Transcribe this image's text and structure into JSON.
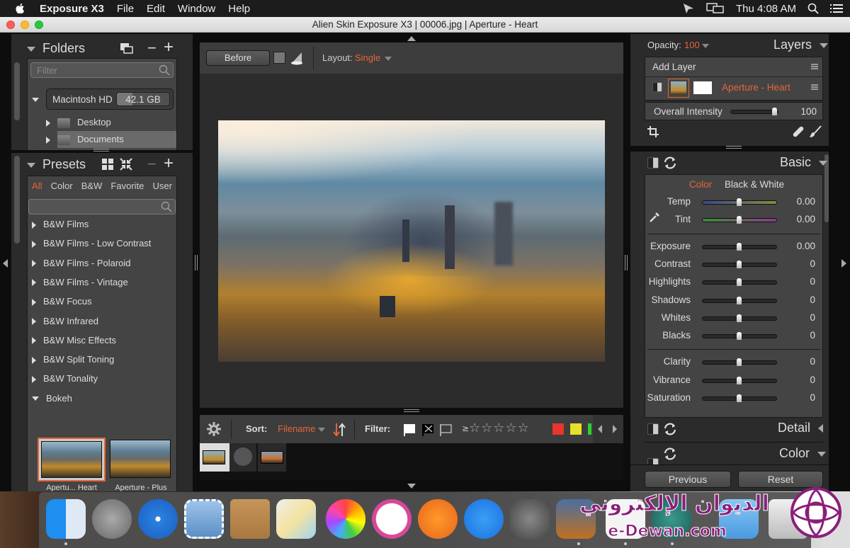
{
  "menubar": {
    "app_name": "Exposure X3",
    "items": [
      "File",
      "Edit",
      "Window",
      "Help"
    ],
    "clock": "Thu 4:08 AM"
  },
  "window": {
    "title": "Alien Skin Exposure X3 | 00006.jpg | Aperture - Heart"
  },
  "folders": {
    "header": "Folders",
    "filter_placeholder": "Filter",
    "drive": {
      "name": "Macintosh HD",
      "size": "42.1 GB",
      "used_fraction": 0.3
    },
    "items": [
      {
        "label": "Desktop",
        "selected": false
      },
      {
        "label": "Documents",
        "selected": true
      }
    ]
  },
  "presets": {
    "header": "Presets",
    "tabs": [
      {
        "label": "All",
        "active": true
      },
      {
        "label": "Color",
        "active": false
      },
      {
        "label": "B&W",
        "active": false
      },
      {
        "label": "Favorite",
        "active": false
      },
      {
        "label": "User",
        "active": false
      }
    ],
    "search_placeholder": "",
    "groups": [
      {
        "label": "B&W Films",
        "expanded": false
      },
      {
        "label": "B&W Films - Low Contrast",
        "expanded": false
      },
      {
        "label": "B&W Films - Polaroid",
        "expanded": false
      },
      {
        "label": "B&W Films - Vintage",
        "expanded": false
      },
      {
        "label": "B&W Focus",
        "expanded": false
      },
      {
        "label": "B&W Infrared",
        "expanded": false
      },
      {
        "label": "B&W Misc Effects",
        "expanded": false
      },
      {
        "label": "B&W Split Toning",
        "expanded": false
      },
      {
        "label": "B&W Tonality",
        "expanded": false
      },
      {
        "label": "Bokeh",
        "expanded": true
      }
    ],
    "thumbnails": [
      {
        "label": "Apertu... Heart",
        "selected": true
      },
      {
        "label": "Aperture - Plus",
        "selected": false
      }
    ]
  },
  "viewer": {
    "before_label": "Before",
    "layout_label": "Layout:",
    "layout_value": "Single"
  },
  "filmstrip": {
    "sort_label": "Sort:",
    "sort_value": "Filename",
    "filter_label": "Filter:",
    "rating_prefix": "≥",
    "stars": 5,
    "color_labels": [
      "#e8362a",
      "#e6e02a",
      "#2ad62a"
    ]
  },
  "layers": {
    "opacity_label": "Opacity:",
    "opacity_value": "100",
    "header": "Layers",
    "add_layer": "Add Layer",
    "layer_name": "Aperture - Heart",
    "intensity_label": "Overall Intensity",
    "intensity_value": "100",
    "intensity_fraction": 1.0
  },
  "basic": {
    "header": "Basic",
    "mode_tabs": [
      {
        "label": "Color",
        "active": true
      },
      {
        "label": "Black & White",
        "active": false
      }
    ],
    "groups": [
      [
        {
          "label": "Temp",
          "value": "0.00",
          "fraction": 0.5
        },
        {
          "label": "Tint",
          "value": "0.00",
          "fraction": 0.5
        }
      ],
      [
        {
          "label": "Exposure",
          "value": "0.00",
          "fraction": 0.5
        },
        {
          "label": "Contrast",
          "value": "0",
          "fraction": 0.5
        },
        {
          "label": "Highlights",
          "value": "0",
          "fraction": 0.5
        },
        {
          "label": "Shadows",
          "value": "0",
          "fraction": 0.5
        },
        {
          "label": "Whites",
          "value": "0",
          "fraction": 0.5
        },
        {
          "label": "Blacks",
          "value": "0",
          "fraction": 0.5
        }
      ],
      [
        {
          "label": "Clarity",
          "value": "0",
          "fraction": 0.5
        },
        {
          "label": "Vibrance",
          "value": "0",
          "fraction": 0.5
        },
        {
          "label": "Saturation",
          "value": "0",
          "fraction": 0.5
        }
      ]
    ]
  },
  "sections": [
    {
      "label": "Detail",
      "collapsed": true
    },
    {
      "label": "Color",
      "collapsed": false
    }
  ],
  "bottom_buttons": {
    "previous": "Previous",
    "reset": "Reset"
  },
  "watermark": {
    "arabic": "الديوان الإلكتروني",
    "latin": "e-Dewan.com"
  },
  "dock": {
    "apps": [
      "Finder",
      "Launchpad",
      "Safari",
      "Mail",
      "Contacts",
      "Maps",
      "Photos",
      "iTunes",
      "iBooks",
      "App Store",
      "System Preferences",
      "Exposure X3",
      "TextEdit",
      "Screenshot",
      "Downloads",
      "Trash"
    ]
  }
}
